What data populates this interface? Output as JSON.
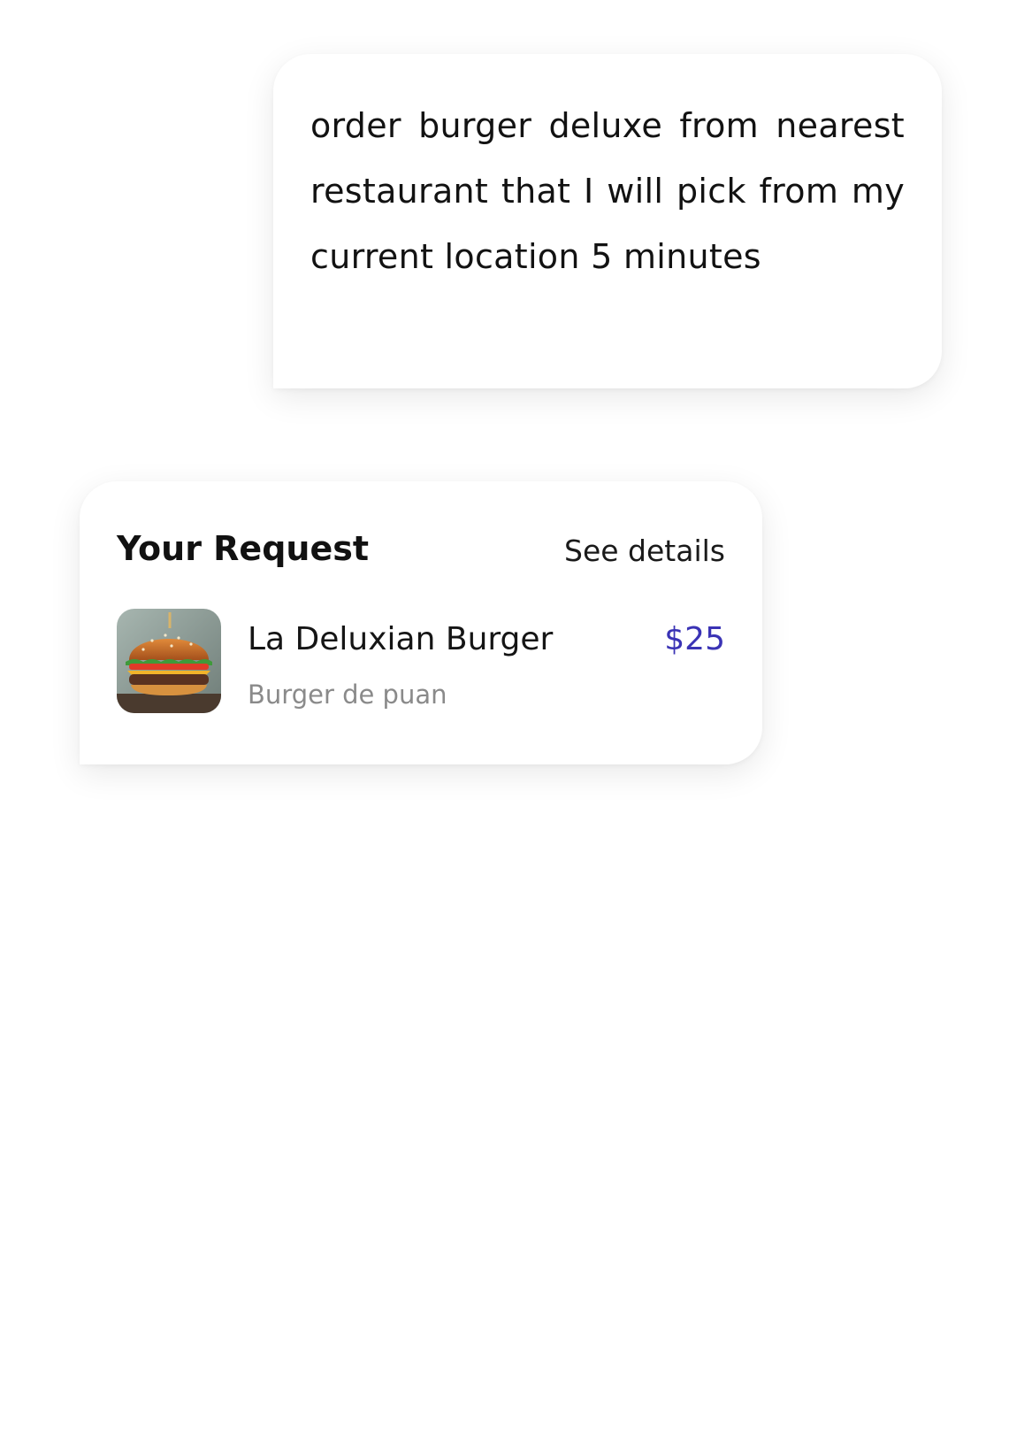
{
  "user_message": {
    "text": "order burger deluxe from nearest restaurant that I will pick from my current location 5 minutes"
  },
  "request_card": {
    "title": "Your Request",
    "details_link": "See details",
    "item": {
      "image_icon": "burger-photo",
      "name": "La Deluxian Burger",
      "subtitle": "Burger de puan",
      "price": "$25"
    }
  },
  "colors": {
    "price": "#3a33b5",
    "subtitle": "#8a8a8a",
    "background": "#ffffff"
  }
}
